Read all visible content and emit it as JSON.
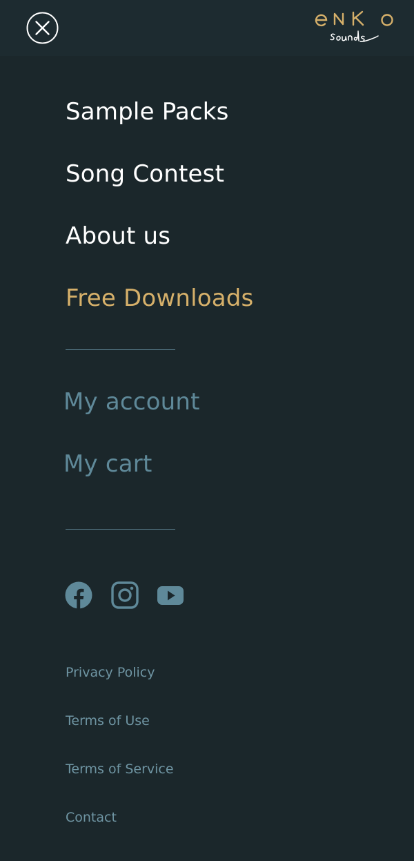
{
  "header": {
    "close_icon": "close-icon",
    "logo": {
      "top_text": "eNKo",
      "script_text": "sounds",
      "color": "#d6b06a"
    }
  },
  "nav": {
    "items": [
      {
        "label": "Sample Packs"
      },
      {
        "label": "Song Contest"
      },
      {
        "label": "About us"
      },
      {
        "label": "Free Downloads",
        "highlighted": true
      }
    ]
  },
  "account": {
    "items": [
      {
        "label": "My account"
      },
      {
        "label": "My cart"
      }
    ]
  },
  "social": [
    {
      "icon": "facebook-icon"
    },
    {
      "icon": "instagram-icon"
    },
    {
      "icon": "youtube-icon"
    }
  ],
  "footer": {
    "links": [
      {
        "label": "Privacy Policy"
      },
      {
        "label": "Terms of Use"
      },
      {
        "label": "Terms of Service"
      },
      {
        "label": "Contact"
      }
    ]
  },
  "colors": {
    "background": "#1b272b",
    "header_background": "#1d2b30",
    "accent": "#d6b06a",
    "muted": "#5f8999"
  }
}
